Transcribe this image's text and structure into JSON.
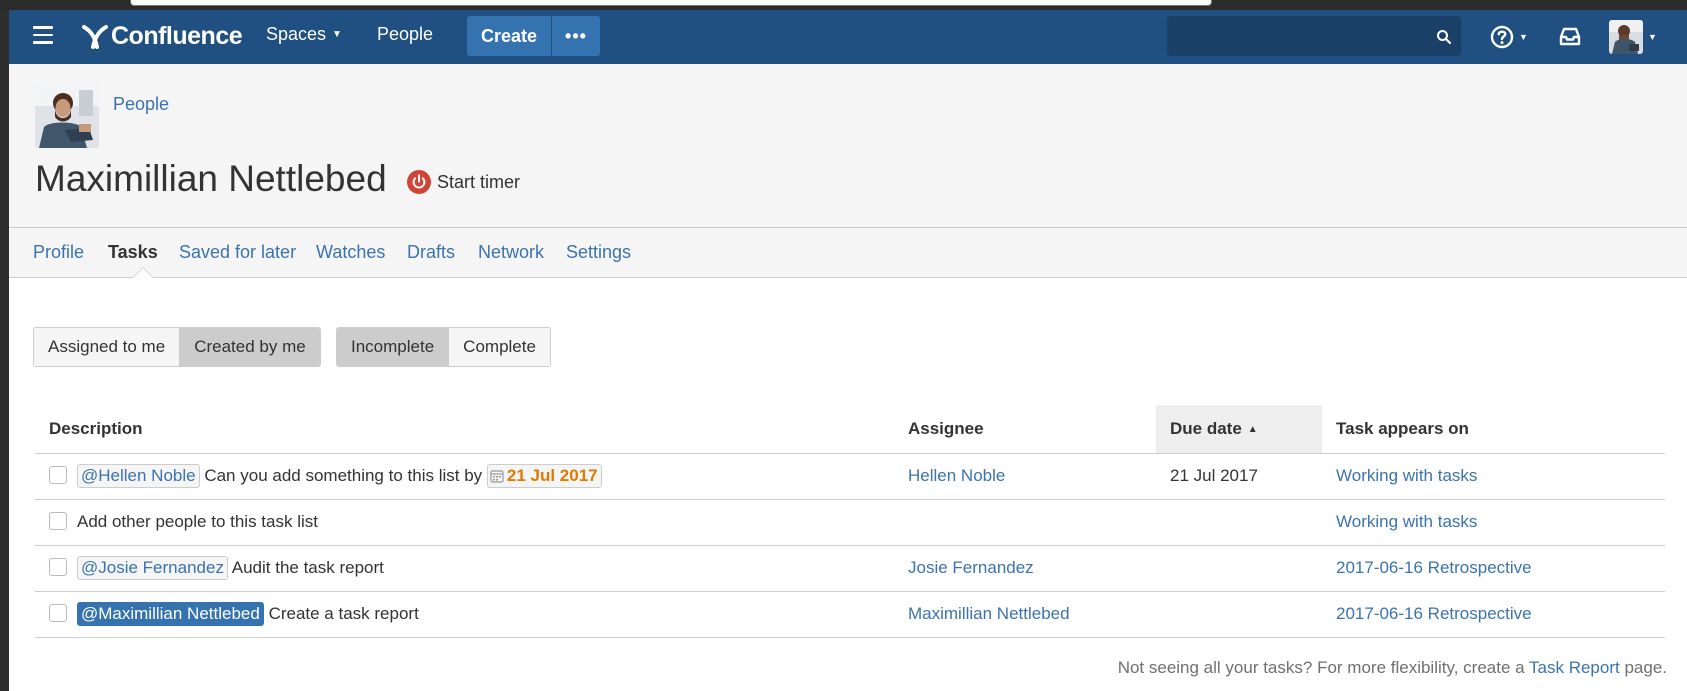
{
  "header": {
    "logo_text": "Confluence",
    "spaces_label": "Spaces",
    "people_label": "People",
    "create_label": "Create",
    "more_label": "•••",
    "search_placeholder": ""
  },
  "profile": {
    "breadcrumb": "People",
    "name": "Maximillian Nettlebed",
    "timer_label": "Start timer"
  },
  "tabs": [
    {
      "label": "Profile",
      "active": false
    },
    {
      "label": "Tasks",
      "active": true
    },
    {
      "label": "Saved for later",
      "active": false
    },
    {
      "label": "Watches",
      "active": false
    },
    {
      "label": "Drafts",
      "active": false
    },
    {
      "label": "Network",
      "active": false
    },
    {
      "label": "Settings",
      "active": false
    }
  ],
  "filters": {
    "assigned_label": "Assigned to me",
    "created_label": "Created by me",
    "selected_owner": "Created by me",
    "incomplete_label": "Incomplete",
    "complete_label": "Complete",
    "selected_status": "Incomplete"
  },
  "table": {
    "columns": {
      "description": "Description",
      "assignee": "Assignee",
      "due_date": "Due date",
      "appears_on": "Task appears on"
    },
    "sorted_by": "Due date",
    "sort_direction": "ascending",
    "rows": [
      {
        "mention": "@Hellen Noble",
        "text": "Can you add something to this list by",
        "date_lozenge": "21 Jul 2017",
        "assignee": "Hellen Noble",
        "due_date": "21 Jul 2017",
        "appears_on": "Working with tasks"
      },
      {
        "mention": "",
        "text": "Add other people to this task list",
        "date_lozenge": "",
        "assignee": "",
        "due_date": "",
        "appears_on": "Working with tasks"
      },
      {
        "mention": "@Josie Fernandez",
        "text": "Audit the task report",
        "date_lozenge": "",
        "assignee": "Josie Fernandez",
        "due_date": "",
        "appears_on": "2017-06-16 Retrospective"
      },
      {
        "mention": "@Maximillian Nettlebed",
        "text": "Create a task report",
        "date_lozenge": "",
        "assignee": "Maximillian Nettlebed",
        "due_date": "",
        "appears_on": "2017-06-16 Retrospective"
      }
    ]
  },
  "footer": {
    "prefix": "Not seeing all your tasks? For more flexibility, create a",
    "link": "Task Report",
    "suffix": "page."
  },
  "colors": {
    "header_bg": "#205081",
    "create_button": "#3572b0",
    "link": "#3b73af",
    "date_lozenge": "#e07b00",
    "timer_red": "#d04437"
  },
  "icons": {
    "menu": "hamburger-menu-icon",
    "search": "search-icon",
    "help": "help-icon",
    "notifications": "notifications-icon",
    "timer": "power-icon",
    "calendar": "calendar-icon"
  }
}
